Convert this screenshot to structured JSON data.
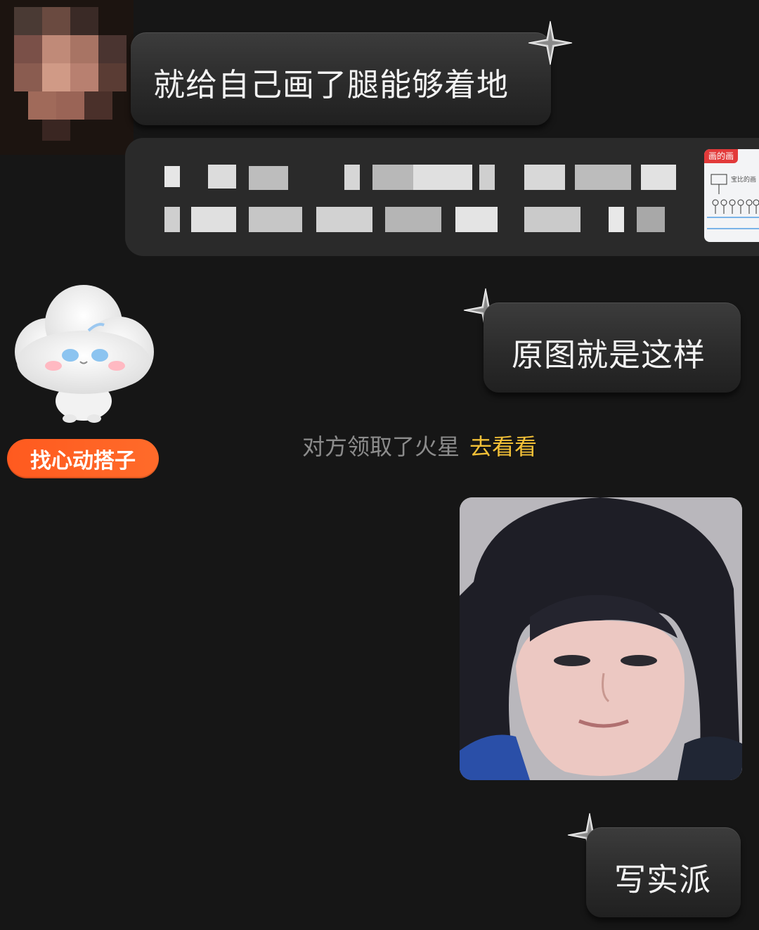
{
  "chat": {
    "messages": {
      "incoming_1": "就给自己画了腿能够着地",
      "outgoing_1": "原图就是这样",
      "outgoing_2": "写实派"
    },
    "quote": {
      "thumb_tag": "画的画",
      "thumb_title": "宝比的画"
    },
    "mascot_button": "找心动搭子",
    "system_notice": {
      "text": "对方领取了火星",
      "link": "去看看"
    }
  },
  "colors": {
    "background": "#161616",
    "bubble": "#2b2b2b",
    "system_text": "#8c8c8c",
    "link": "#f2c037",
    "mascot_button": "#ff5a1f"
  },
  "icons": [
    "sparkle-icon",
    "mascot-cloud",
    "avatar"
  ]
}
